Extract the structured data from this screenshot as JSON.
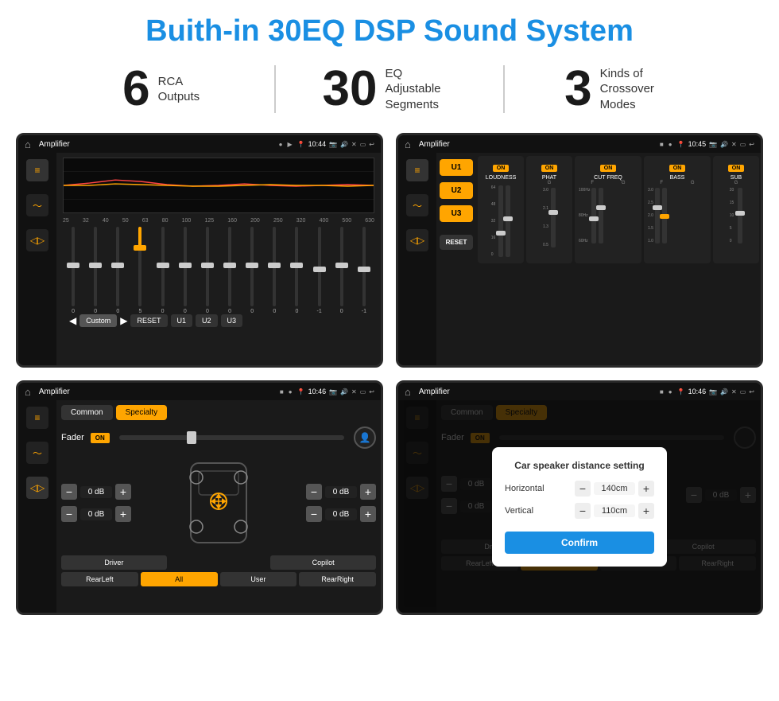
{
  "page": {
    "title": "Buith-in 30EQ DSP Sound System"
  },
  "stats": [
    {
      "number": "6",
      "text_line1": "RCA",
      "text_line2": "Outputs"
    },
    {
      "number": "30",
      "text_line1": "EQ Adjustable",
      "text_line2": "Segments"
    },
    {
      "number": "3",
      "text_line1": "Kinds of",
      "text_line2": "Crossover Modes"
    }
  ],
  "screen1": {
    "status": {
      "title": "Amplifier",
      "time": "10:44"
    },
    "eq_labels": [
      "25",
      "32",
      "40",
      "50",
      "63",
      "80",
      "100",
      "125",
      "160",
      "200",
      "250",
      "320",
      "400",
      "500",
      "630"
    ],
    "eq_values": [
      "0",
      "0",
      "0",
      "5",
      "0",
      "0",
      "0",
      "0",
      "0",
      "0",
      "0",
      "-1",
      "0",
      "-1"
    ],
    "preset": "Custom",
    "buttons": [
      "RESET",
      "U1",
      "U2",
      "U3"
    ]
  },
  "screen2": {
    "status": {
      "title": "Amplifier",
      "time": "10:45"
    },
    "presets": [
      "U1",
      "U2",
      "U3"
    ],
    "modules": [
      {
        "name": "LOUDNESS",
        "on": true
      },
      {
        "name": "PHAT",
        "on": true
      },
      {
        "name": "CUT FREQ",
        "on": true
      },
      {
        "name": "BASS",
        "on": true
      },
      {
        "name": "SUB",
        "on": true
      }
    ],
    "reset_label": "RESET"
  },
  "screen3": {
    "status": {
      "title": "Amplifier",
      "time": "10:46"
    },
    "tabs": [
      "Common",
      "Specialty"
    ],
    "active_tab": "Specialty",
    "fader_label": "Fader",
    "fader_on": "ON",
    "levels": [
      "0 dB",
      "0 dB",
      "0 dB",
      "0 dB"
    ],
    "bottom_buttons": [
      "Driver",
      "",
      "Copilot",
      "RearLeft",
      "All",
      "User",
      "RearRight"
    ]
  },
  "screen4": {
    "status": {
      "title": "Amplifier",
      "time": "10:46"
    },
    "tabs": [
      "Common",
      "Specialty"
    ],
    "fader_label": "Fader",
    "fader_on": "ON",
    "dialog": {
      "title": "Car speaker distance setting",
      "horizontal_label": "Horizontal",
      "horizontal_value": "140cm",
      "vertical_label": "Vertical",
      "vertical_value": "110cm",
      "confirm_label": "Confirm"
    },
    "levels": [
      "0 dB",
      "0 dB"
    ],
    "bottom_buttons": [
      "Driver",
      "Copilot",
      "RearLeft",
      "User",
      "RearRight"
    ]
  }
}
